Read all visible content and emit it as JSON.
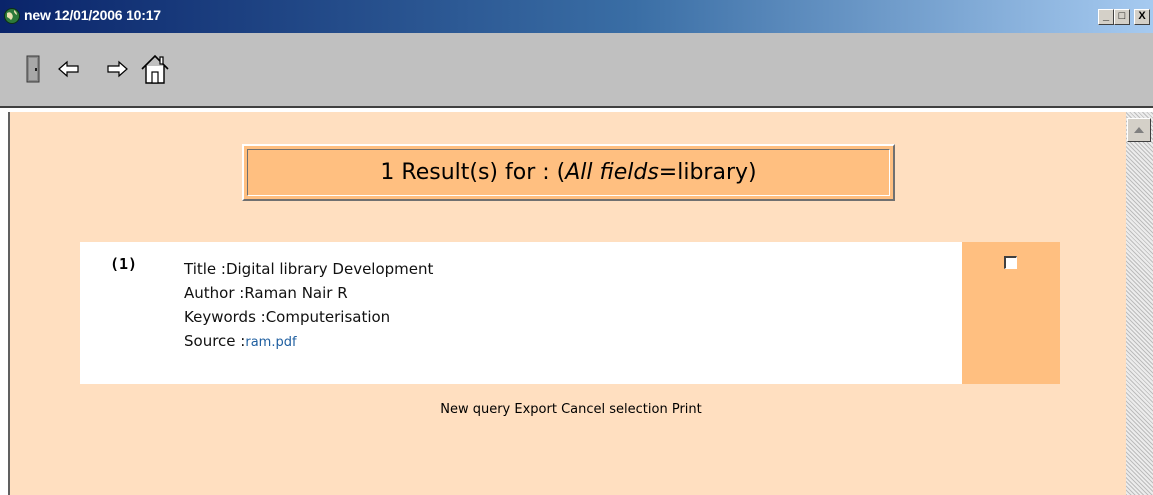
{
  "window": {
    "title": "new 12/01/2006 10:17",
    "min_label": "_",
    "max_label": "□",
    "close_label": "X"
  },
  "toolbar": {
    "icons": [
      "door-icon",
      "back-arrow-icon",
      "forward-arrow-icon",
      "home-icon"
    ]
  },
  "results": {
    "count_text": "1 Result(s) for : (",
    "field_text": "All fields",
    "query_text": "=library)"
  },
  "record": {
    "number": "(1)",
    "title_label": "Title :",
    "title_value": "Digital library Development",
    "author_label": "Author :",
    "author_value": "Raman Nair R",
    "keywords_label": "Keywords :",
    "keywords_value": "Computerisation",
    "source_label": "Source :",
    "source_value": "ram.pdf",
    "selected": false
  },
  "actions": {
    "new_query": "New query",
    "export": "Export",
    "cancel_selection": "Cancel selection",
    "print": "Print"
  },
  "colors": {
    "content_bg": "#ffdfc0",
    "accent": "#ffbf80",
    "link": "#1f5fa0",
    "titlebar": "#0a246a"
  }
}
